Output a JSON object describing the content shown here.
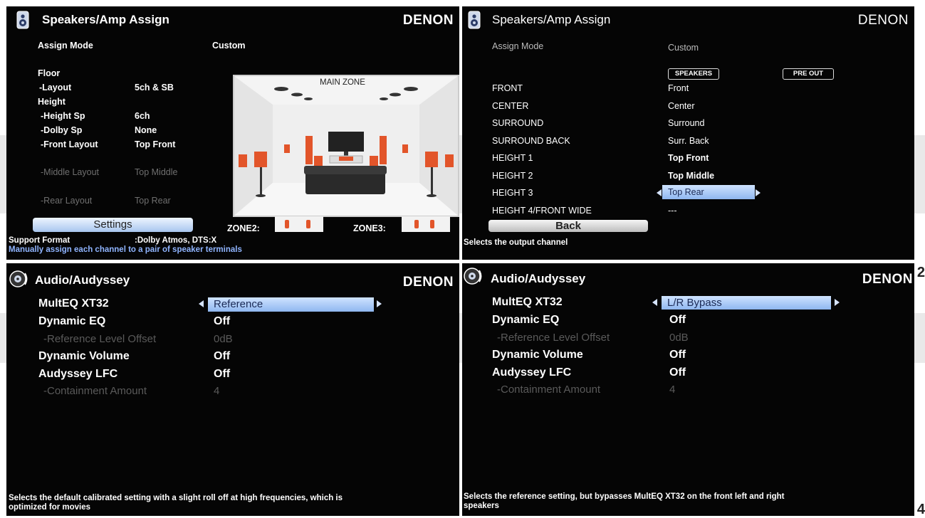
{
  "page_numbers": {
    "right_top": "2",
    "right_bottom": "4"
  },
  "brand": "DENON",
  "panel1": {
    "title": "Speakers/Amp Assign",
    "assign_mode_label": "Assign Mode",
    "assign_mode_value": "Custom",
    "rows": [
      {
        "label": "Floor",
        "value": ""
      },
      {
        "label": "-Layout",
        "value": "5ch & SB"
      },
      {
        "label": "Height",
        "value": ""
      },
      {
        "label": "-Height Sp",
        "value": "6ch"
      },
      {
        "label": "-Dolby Sp",
        "value": "None"
      },
      {
        "label": "-Front Layout",
        "value": "Top Front"
      },
      {
        "label": "-Middle Layout",
        "value": "Top Middle"
      },
      {
        "label": "-Rear Layout",
        "value": "Top Rear"
      }
    ],
    "main_zone_label": "MAIN ZONE",
    "settings_button": "Settings",
    "zone2_label": "ZONE2:",
    "zone3_label": "ZONE3:",
    "support_label": "Support Format",
    "support_value": ":Dolby Atmos, DTS:X",
    "footer": "Manually assign each channel to a pair of speaker terminals"
  },
  "panel2": {
    "title": "Speakers/Amp Assign",
    "assign_mode_label": "Assign Mode",
    "assign_mode_value": "Custom",
    "col_speakers": "SPEAKERS",
    "col_preout": "PRE OUT",
    "rows": [
      {
        "label": "FRONT",
        "speakers": "Front"
      },
      {
        "label": "CENTER",
        "speakers": "Center"
      },
      {
        "label": "SURROUND",
        "speakers": "Surround"
      },
      {
        "label": "SURROUND BACK",
        "speakers": "Surr. Back"
      },
      {
        "label": "HEIGHT 1",
        "speakers": "Top Front"
      },
      {
        "label": "HEIGHT 2",
        "speakers": "Top Middle"
      },
      {
        "label": "HEIGHT 3",
        "speakers": "Top Rear"
      },
      {
        "label": "HEIGHT 4/FRONT WIDE",
        "speakers": "---"
      }
    ],
    "back_button": "Back",
    "footer": "Selects the output channel"
  },
  "panel3": {
    "title": "Audio/Audyssey",
    "rows": [
      {
        "label": "MultEQ XT32",
        "value": "Reference"
      },
      {
        "label": "Dynamic EQ",
        "value": "Off"
      },
      {
        "label": "-Reference Level Offset",
        "value": "0dB"
      },
      {
        "label": "Dynamic Volume",
        "value": "Off"
      },
      {
        "label": "Audyssey LFC",
        "value": "Off"
      },
      {
        "label": "-Containment Amount",
        "value": "4"
      }
    ],
    "footer_line1": "Selects the default calibrated setting with a slight roll off at high frequencies, which is",
    "footer_line2": "optimized for movies"
  },
  "panel4": {
    "title": "Audio/Audyssey",
    "rows": [
      {
        "label": "MultEQ XT32",
        "value": "L/R Bypass"
      },
      {
        "label": "Dynamic EQ",
        "value": "Off"
      },
      {
        "label": "-Reference Level Offset",
        "value": "0dB"
      },
      {
        "label": "Dynamic Volume",
        "value": "Off"
      },
      {
        "label": "Audyssey LFC",
        "value": "Off"
      },
      {
        "label": "-Containment Amount",
        "value": "4"
      }
    ],
    "footer_line1": "Selects the reference setting, but bypasses MultEQ XT32 on the front left and right",
    "footer_line2": "speakers"
  },
  "colors": {
    "highlight": "#8fb7f0",
    "footer_blue": "#8fb4ff",
    "speaker_orange": "#e2552a"
  },
  "icons": {
    "speaker": "speaker-icon",
    "audio": "audio-disc-icon"
  }
}
